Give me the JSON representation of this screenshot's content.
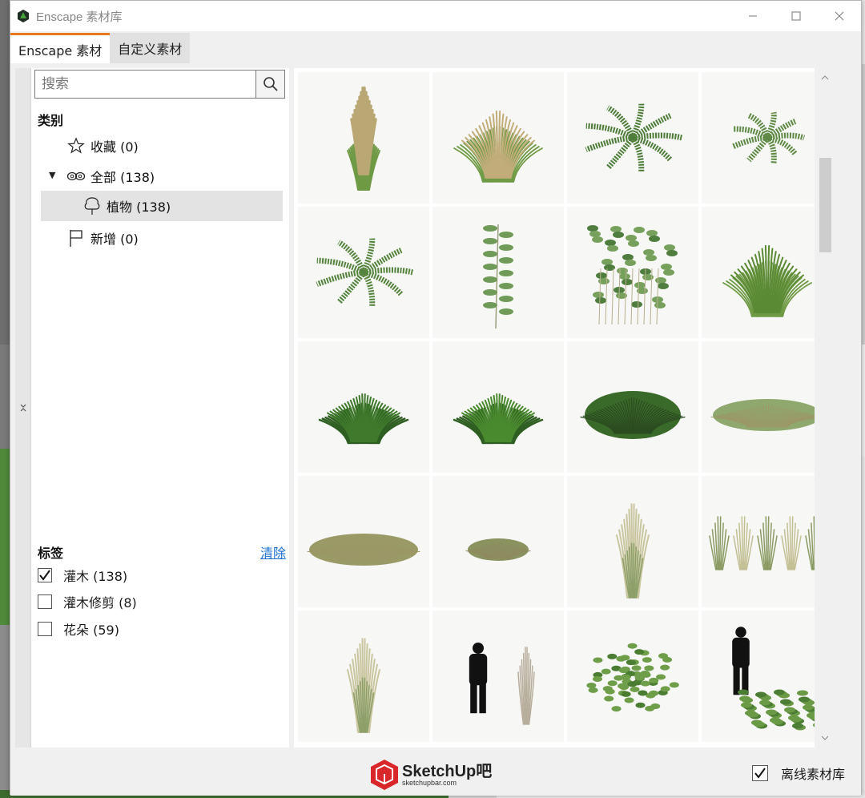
{
  "window": {
    "title": "Enscape 素材库",
    "controls": [
      "minimize-icon",
      "maximize-icon",
      "close-icon"
    ]
  },
  "tabs": [
    {
      "label": "Enscape 素材",
      "active": true
    },
    {
      "label": "自定义素材",
      "active": false
    }
  ],
  "sidebar": {
    "search_placeholder": "搜索",
    "categories_label": "类别",
    "categories": [
      {
        "label": "收藏 (0)",
        "icon": "star-icon"
      },
      {
        "label": "全部 (138)",
        "icon": "infinity-icon",
        "expanded": true
      },
      {
        "label": "植物 (138)",
        "icon": "tree-icon",
        "selected": true
      },
      {
        "label": "新增 (0)",
        "icon": "flag-icon"
      }
    ],
    "tags_label": "标签",
    "clear_label": "清除",
    "tags": [
      {
        "label": "灌木 (138)",
        "checked": true
      },
      {
        "label": "灌木修剪 (8)",
        "checked": false
      },
      {
        "label": "花朵 (59)",
        "checked": false
      }
    ]
  },
  "assets": [
    {
      "name": "tall-feather-grass",
      "kind": "tall-grass",
      "color": "#b9a774"
    },
    {
      "name": "fountain-grass",
      "kind": "fountain",
      "color": "#c2ad7a"
    },
    {
      "name": "fern-dark",
      "kind": "fern",
      "color": "#4e7d3a"
    },
    {
      "name": "fern-light",
      "kind": "fern-small",
      "color": "#5e8a45"
    },
    {
      "name": "fern-spread",
      "kind": "fern",
      "color": "#55843e"
    },
    {
      "name": "leafy-stalk",
      "kind": "stalk",
      "color": "#6f9a57"
    },
    {
      "name": "leafy-shrub",
      "kind": "shrub-tall",
      "color": "#76a05c"
    },
    {
      "name": "green-grass-clump",
      "kind": "fountain",
      "color": "#5a8a34"
    },
    {
      "name": "grass-tuft-1",
      "kind": "tuft",
      "color": "#3f7a2c"
    },
    {
      "name": "grass-tuft-2",
      "kind": "tuft",
      "color": "#4a8a2e"
    },
    {
      "name": "grass-mound-dark",
      "kind": "mound",
      "color": "#3a6a2a"
    },
    {
      "name": "grass-mound-flat",
      "kind": "flat",
      "color": "#7c9a55"
    },
    {
      "name": "grass-patch-dry",
      "kind": "flat",
      "color": "#8a8a4e"
    },
    {
      "name": "grass-patch-small",
      "kind": "flat-small",
      "color": "#7d8650"
    },
    {
      "name": "reed-grass",
      "kind": "reed",
      "color": "#b8b98c"
    },
    {
      "name": "reed-row",
      "kind": "reed-row",
      "color": "#b3b384"
    },
    {
      "name": "pampas-tall",
      "kind": "reed",
      "color": "#c6c39a"
    },
    {
      "name": "pampas-with-person",
      "kind": "person-reed",
      "color": "#b9b0a2"
    },
    {
      "name": "round-shrub",
      "kind": "shrub-round",
      "color": "#6e9e4a"
    },
    {
      "name": "shrub-with-person",
      "kind": "person-shrub",
      "color": "#6b9a46"
    }
  ],
  "footer": {
    "offline_label": "离线素材库",
    "offline_checked": true,
    "watermark_main": "SketchUp吧",
    "watermark_sub": "sketchupbar.com"
  }
}
